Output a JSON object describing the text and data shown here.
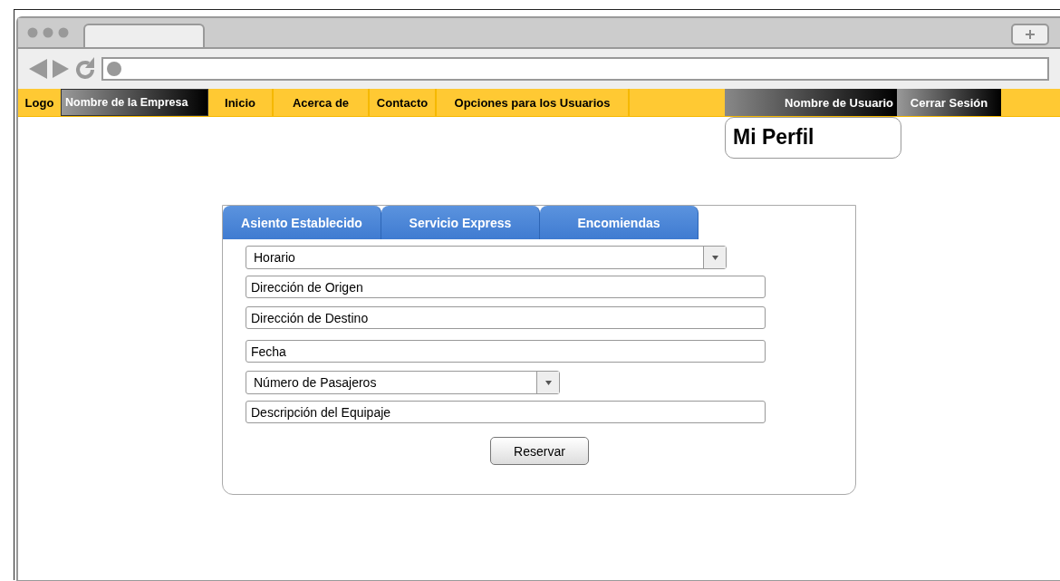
{
  "nav": {
    "logo": "Logo",
    "company": "Nombre de la Empresa",
    "links": [
      {
        "label": "Inicio"
      },
      {
        "label": "Acerca de"
      },
      {
        "label": "Contacto"
      },
      {
        "label": "Opciones para los Usuarios"
      }
    ],
    "user": "Nombre de Usuario",
    "logout": "Cerrar Sesión"
  },
  "profile_popup": {
    "label": "Mi Perfil"
  },
  "tabs": [
    {
      "label": "Asiento Establecido"
    },
    {
      "label": "Servicio Express"
    },
    {
      "label": "Encomiendas"
    }
  ],
  "form": {
    "fields": [
      {
        "kind": "select",
        "value": "Horario"
      },
      {
        "kind": "text",
        "value": "Dirección de Origen"
      },
      {
        "kind": "text",
        "value": "Dirección de Destino"
      },
      {
        "kind": "text",
        "value": "Fecha"
      },
      {
        "kind": "select",
        "value": "Número de Pasajeros"
      },
      {
        "kind": "text",
        "value": "Descripción del Equipaje"
      }
    ],
    "submit": "Reservar"
  }
}
